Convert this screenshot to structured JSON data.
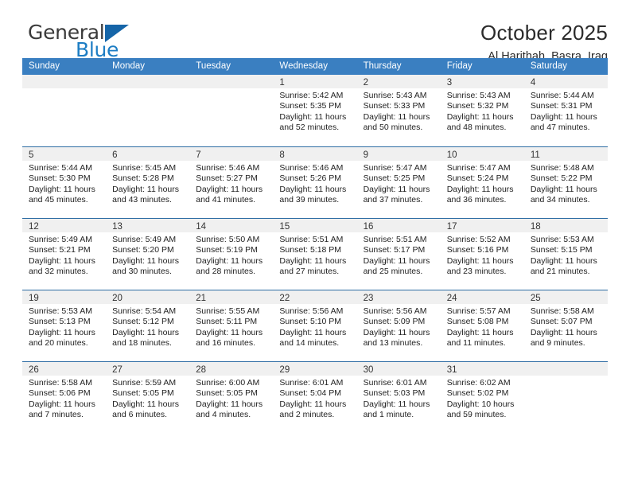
{
  "brand": {
    "name_top": "General",
    "name_bottom": "Blue",
    "triangle_icon": "triangle-icon",
    "color_dark": "#3a3a3a",
    "color_blue": "#1d7dc4"
  },
  "header": {
    "title": "October 2025",
    "subtitle": "Al Harithah, Basra, Iraq"
  },
  "calendar": {
    "accent_color": "#3a7fc1",
    "weekdays": [
      "Sunday",
      "Monday",
      "Tuesday",
      "Wednesday",
      "Thursday",
      "Friday",
      "Saturday"
    ],
    "weeks": [
      [
        {
          "day": "",
          "sunrise": "",
          "sunset": "",
          "daylight1": "",
          "daylight2": "",
          "empty": true
        },
        {
          "day": "",
          "sunrise": "",
          "sunset": "",
          "daylight1": "",
          "daylight2": "",
          "empty": true
        },
        {
          "day": "",
          "sunrise": "",
          "sunset": "",
          "daylight1": "",
          "daylight2": "",
          "empty": true
        },
        {
          "day": "1",
          "sunrise": "Sunrise: 5:42 AM",
          "sunset": "Sunset: 5:35 PM",
          "daylight1": "Daylight: 11 hours",
          "daylight2": "and 52 minutes."
        },
        {
          "day": "2",
          "sunrise": "Sunrise: 5:43 AM",
          "sunset": "Sunset: 5:33 PM",
          "daylight1": "Daylight: 11 hours",
          "daylight2": "and 50 minutes."
        },
        {
          "day": "3",
          "sunrise": "Sunrise: 5:43 AM",
          "sunset": "Sunset: 5:32 PM",
          "daylight1": "Daylight: 11 hours",
          "daylight2": "and 48 minutes."
        },
        {
          "day": "4",
          "sunrise": "Sunrise: 5:44 AM",
          "sunset": "Sunset: 5:31 PM",
          "daylight1": "Daylight: 11 hours",
          "daylight2": "and 47 minutes."
        }
      ],
      [
        {
          "day": "5",
          "sunrise": "Sunrise: 5:44 AM",
          "sunset": "Sunset: 5:30 PM",
          "daylight1": "Daylight: 11 hours",
          "daylight2": "and 45 minutes."
        },
        {
          "day": "6",
          "sunrise": "Sunrise: 5:45 AM",
          "sunset": "Sunset: 5:28 PM",
          "daylight1": "Daylight: 11 hours",
          "daylight2": "and 43 minutes."
        },
        {
          "day": "7",
          "sunrise": "Sunrise: 5:46 AM",
          "sunset": "Sunset: 5:27 PM",
          "daylight1": "Daylight: 11 hours",
          "daylight2": "and 41 minutes."
        },
        {
          "day": "8",
          "sunrise": "Sunrise: 5:46 AM",
          "sunset": "Sunset: 5:26 PM",
          "daylight1": "Daylight: 11 hours",
          "daylight2": "and 39 minutes."
        },
        {
          "day": "9",
          "sunrise": "Sunrise: 5:47 AM",
          "sunset": "Sunset: 5:25 PM",
          "daylight1": "Daylight: 11 hours",
          "daylight2": "and 37 minutes."
        },
        {
          "day": "10",
          "sunrise": "Sunrise: 5:47 AM",
          "sunset": "Sunset: 5:24 PM",
          "daylight1": "Daylight: 11 hours",
          "daylight2": "and 36 minutes."
        },
        {
          "day": "11",
          "sunrise": "Sunrise: 5:48 AM",
          "sunset": "Sunset: 5:22 PM",
          "daylight1": "Daylight: 11 hours",
          "daylight2": "and 34 minutes."
        }
      ],
      [
        {
          "day": "12",
          "sunrise": "Sunrise: 5:49 AM",
          "sunset": "Sunset: 5:21 PM",
          "daylight1": "Daylight: 11 hours",
          "daylight2": "and 32 minutes."
        },
        {
          "day": "13",
          "sunrise": "Sunrise: 5:49 AM",
          "sunset": "Sunset: 5:20 PM",
          "daylight1": "Daylight: 11 hours",
          "daylight2": "and 30 minutes."
        },
        {
          "day": "14",
          "sunrise": "Sunrise: 5:50 AM",
          "sunset": "Sunset: 5:19 PM",
          "daylight1": "Daylight: 11 hours",
          "daylight2": "and 28 minutes."
        },
        {
          "day": "15",
          "sunrise": "Sunrise: 5:51 AM",
          "sunset": "Sunset: 5:18 PM",
          "daylight1": "Daylight: 11 hours",
          "daylight2": "and 27 minutes."
        },
        {
          "day": "16",
          "sunrise": "Sunrise: 5:51 AM",
          "sunset": "Sunset: 5:17 PM",
          "daylight1": "Daylight: 11 hours",
          "daylight2": "and 25 minutes."
        },
        {
          "day": "17",
          "sunrise": "Sunrise: 5:52 AM",
          "sunset": "Sunset: 5:16 PM",
          "daylight1": "Daylight: 11 hours",
          "daylight2": "and 23 minutes."
        },
        {
          "day": "18",
          "sunrise": "Sunrise: 5:53 AM",
          "sunset": "Sunset: 5:15 PM",
          "daylight1": "Daylight: 11 hours",
          "daylight2": "and 21 minutes."
        }
      ],
      [
        {
          "day": "19",
          "sunrise": "Sunrise: 5:53 AM",
          "sunset": "Sunset: 5:13 PM",
          "daylight1": "Daylight: 11 hours",
          "daylight2": "and 20 minutes."
        },
        {
          "day": "20",
          "sunrise": "Sunrise: 5:54 AM",
          "sunset": "Sunset: 5:12 PM",
          "daylight1": "Daylight: 11 hours",
          "daylight2": "and 18 minutes."
        },
        {
          "day": "21",
          "sunrise": "Sunrise: 5:55 AM",
          "sunset": "Sunset: 5:11 PM",
          "daylight1": "Daylight: 11 hours",
          "daylight2": "and 16 minutes."
        },
        {
          "day": "22",
          "sunrise": "Sunrise: 5:56 AM",
          "sunset": "Sunset: 5:10 PM",
          "daylight1": "Daylight: 11 hours",
          "daylight2": "and 14 minutes."
        },
        {
          "day": "23",
          "sunrise": "Sunrise: 5:56 AM",
          "sunset": "Sunset: 5:09 PM",
          "daylight1": "Daylight: 11 hours",
          "daylight2": "and 13 minutes."
        },
        {
          "day": "24",
          "sunrise": "Sunrise: 5:57 AM",
          "sunset": "Sunset: 5:08 PM",
          "daylight1": "Daylight: 11 hours",
          "daylight2": "and 11 minutes."
        },
        {
          "day": "25",
          "sunrise": "Sunrise: 5:58 AM",
          "sunset": "Sunset: 5:07 PM",
          "daylight1": "Daylight: 11 hours",
          "daylight2": "and 9 minutes."
        }
      ],
      [
        {
          "day": "26",
          "sunrise": "Sunrise: 5:58 AM",
          "sunset": "Sunset: 5:06 PM",
          "daylight1": "Daylight: 11 hours",
          "daylight2": "and 7 minutes."
        },
        {
          "day": "27",
          "sunrise": "Sunrise: 5:59 AM",
          "sunset": "Sunset: 5:05 PM",
          "daylight1": "Daylight: 11 hours",
          "daylight2": "and 6 minutes."
        },
        {
          "day": "28",
          "sunrise": "Sunrise: 6:00 AM",
          "sunset": "Sunset: 5:05 PM",
          "daylight1": "Daylight: 11 hours",
          "daylight2": "and 4 minutes."
        },
        {
          "day": "29",
          "sunrise": "Sunrise: 6:01 AM",
          "sunset": "Sunset: 5:04 PM",
          "daylight1": "Daylight: 11 hours",
          "daylight2": "and 2 minutes."
        },
        {
          "day": "30",
          "sunrise": "Sunrise: 6:01 AM",
          "sunset": "Sunset: 5:03 PM",
          "daylight1": "Daylight: 11 hours",
          "daylight2": "and 1 minute."
        },
        {
          "day": "31",
          "sunrise": "Sunrise: 6:02 AM",
          "sunset": "Sunset: 5:02 PM",
          "daylight1": "Daylight: 10 hours",
          "daylight2": "and 59 minutes."
        },
        {
          "day": "",
          "sunrise": "",
          "sunset": "",
          "daylight1": "",
          "daylight2": "",
          "empty": true
        }
      ]
    ]
  }
}
